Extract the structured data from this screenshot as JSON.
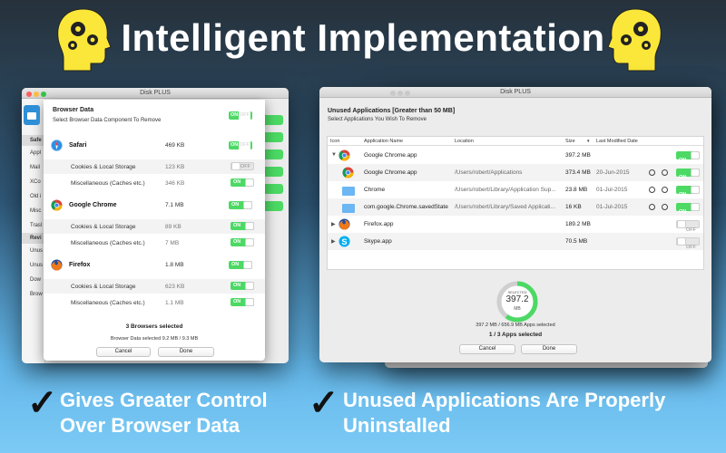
{
  "headline": "Intelligent Implementation",
  "colors": {
    "on": "#4cd964",
    "brain": "#fbe739",
    "accent": "#2e8fd6"
  },
  "left_window": {
    "title": "Disk PLUS",
    "sidebar": [
      "Safe",
      "Appl",
      "Mail",
      "XCo",
      "Old i",
      "Misc",
      "Trasl",
      "Revi",
      "Unus",
      "Unus",
      "Dow",
      "Brow"
    ],
    "sheet": {
      "title": "Browser Data",
      "subtitle": "Select Browser Data Component To Remove",
      "header_toggle": {
        "on": "ON",
        "off": "OFF"
      },
      "browsers": [
        {
          "name": "Safari",
          "icon": "safari-icon",
          "size": "469 KB",
          "toggle": "ON|OFF",
          "items": [
            {
              "label": "Cookies & Local Storage",
              "size": "123 KB",
              "state": "OFF"
            },
            {
              "label": "Miscellaneous (Caches etc.)",
              "size": "346 KB",
              "state": "ON"
            }
          ]
        },
        {
          "name": "Google Chrome",
          "icon": "chrome-icon",
          "size": "7.1 MB",
          "toggle": "ON",
          "items": [
            {
              "label": "Cookies & Local Storage",
              "size": "89 KB",
              "state": "ON"
            },
            {
              "label": "Miscellaneous (Caches etc.)",
              "size": "7 MB",
              "state": "ON"
            }
          ]
        },
        {
          "name": "Firefox",
          "icon": "firefox-icon",
          "size": "1.8 MB",
          "toggle": "ON",
          "items": [
            {
              "label": "Cookies & Local Storage",
              "size": "623 KB",
              "state": "ON"
            },
            {
              "label": "Miscellaneous (Caches etc.)",
              "size": "1.1 MB",
              "state": "ON"
            }
          ]
        }
      ],
      "summary": "3 Browsers selected",
      "detail": "Browser Data selected 9.2 MB / 9.3 MB",
      "cancel": "Cancel",
      "done": "Done"
    }
  },
  "right_window": {
    "title": "Disk PLUS",
    "heading": "Unused Applications [Greater than 50 MB]",
    "subheading": "Select Applications You Wish To Remove",
    "columns": [
      "Icon",
      "Application Name",
      "Location",
      "Size",
      "Last Modified Date"
    ],
    "rows": [
      {
        "name": "Google Chrome.app",
        "location": "",
        "size": "397.2 MB",
        "date": "",
        "state": "ON",
        "expanded": true,
        "level": 0
      },
      {
        "name": "Google Chrome.app",
        "location": "/Users/robert/Applications",
        "size": "373.4 MB",
        "date": "20-Jun-2015",
        "state": "ON",
        "level": 1
      },
      {
        "name": "Chrome",
        "location": "/Users/robert/Library/Application Sup...",
        "size": "23.8 MB",
        "date": "01-Jul-2015",
        "state": "ON",
        "level": 1
      },
      {
        "name": "com.google.Chrome.savedState",
        "location": "/Users/robert/Library/Saved Applicati...",
        "size": "16 KB",
        "date": "01-Jul-2015",
        "state": "ON",
        "level": 1
      },
      {
        "name": "Firefox.app",
        "location": "",
        "size": "189.2 MB",
        "date": "",
        "state": "OFF",
        "level": 0
      },
      {
        "name": "Skype.app",
        "location": "",
        "size": "70.5 MB",
        "date": "",
        "state": "OFF",
        "level": 0
      }
    ],
    "gauge": {
      "label": "SELECTED",
      "value": "397.2",
      "unit": "MB",
      "fraction": 0.6
    },
    "summary": "397.2 MB / 656.9 MB Apps selected",
    "count": "1 / 3 Apps selected",
    "cancel": "Cancel",
    "done": "Done"
  },
  "captions": {
    "left": [
      "Gives Greater Control",
      "Over Browser Data"
    ],
    "right": [
      "Unused Applications Are Properly",
      "Uninstalled"
    ],
    "check": "✓"
  }
}
